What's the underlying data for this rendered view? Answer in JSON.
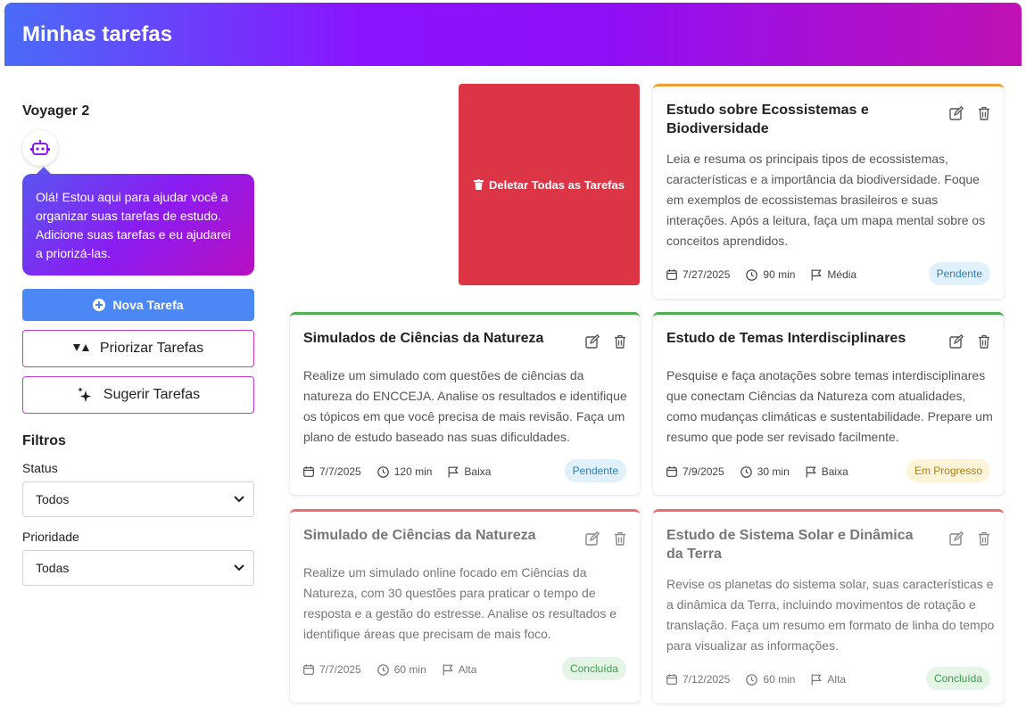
{
  "header": {
    "title": "Minhas tarefas"
  },
  "assistant": {
    "name": "Voyager 2",
    "message": "Olá! Estou aqui para ajudar você a organizar suas tarefas de estudo. Adicione suas tarefas e eu ajudarei a priorizá-las."
  },
  "actions": {
    "new_task": "Nova Tarefa",
    "prioritize": "Priorizar Tarefas",
    "suggest": "Sugerir Tarefas",
    "delete_all": "Deletar Todas as Tarefas"
  },
  "filters": {
    "title": "Filtros",
    "status_label": "Status",
    "status_value": "Todos",
    "priority_label": "Prioridade",
    "priority_value": "Todas"
  },
  "colors": {
    "primary": "#4b87f5",
    "danger": "#dc3545",
    "accent_border": "#c43ad0",
    "prio_media": "#f0a030",
    "prio_baixa": "#4caf50",
    "prio_alta": "#ef6b6b"
  },
  "tasks": [
    {
      "title": "Estudo sobre Ecossistemas e Biodiversidade",
      "description": "Leia e resuma os principais tipos de ecossistemas, características e a importância da biodiversidade. Foque em exemplos de ecossistemas brasileiros e suas interações. Após a leitura, faça um mapa mental sobre os conceitos aprendidos.",
      "date": "7/27/2025",
      "duration": "90 min",
      "priority": "Média",
      "status": "Pendente"
    },
    {
      "title": "Simulados de Ciências da Natureza",
      "description": "Realize um simulado com questões de ciências da natureza do ENCCEJA. Analise os resultados e identifique os tópicos em que você precisa de mais revisão. Faça um plano de estudo baseado nas suas dificuldades.",
      "date": "7/7/2025",
      "duration": "120 min",
      "priority": "Baixa",
      "status": "Pendente"
    },
    {
      "title": "Estudo de Temas Interdisciplinares",
      "description": "Pesquise e faça anotações sobre temas interdisciplinares que conectam Ciências da Natureza com atualidades, como mudanças climáticas e sustentabilidade. Prepare um resumo que pode ser revisado facilmente.",
      "date": "7/9/2025",
      "duration": "30 min",
      "priority": "Baixa",
      "status": "Em Progresso"
    },
    {
      "title": "Simulado de Ciências da Natureza",
      "description": "Realize um simulado online focado em Ciências da Natureza, com 30 questões para praticar o tempo de resposta e a gestão do estresse. Analise os resultados e identifique áreas que precisam de mais foco.",
      "date": "7/7/2025",
      "duration": "60 min",
      "priority": "Alta",
      "status": "Concluída"
    },
    {
      "title": "Estudo de Sistema Solar e Dinâmica da Terra",
      "description": "Revise os planetas do sistema solar, suas características e a dinâmica da Terra, incluindo movimentos de rotação e translação. Faça um resumo em formato de linha do tempo para visualizar as informações.",
      "date": "7/12/2025",
      "duration": "60 min",
      "priority": "Alta",
      "status": "Concluída"
    }
  ]
}
